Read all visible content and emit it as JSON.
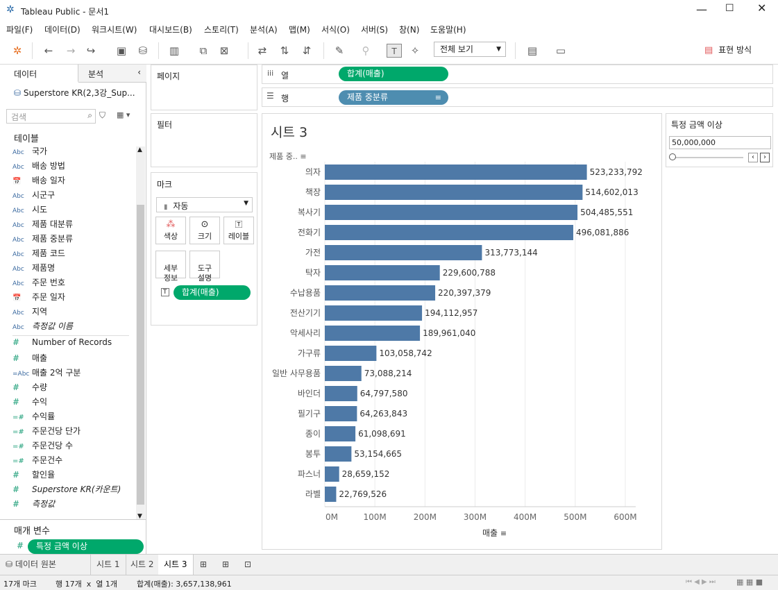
{
  "window": {
    "title": "Tableau Public - 문서1"
  },
  "menu": [
    "파일(F)",
    "데이터(D)",
    "워크시트(W)",
    "대시보드(B)",
    "스토리(T)",
    "분석(A)",
    "맵(M)",
    "서식(O)",
    "서버(S)",
    "창(N)",
    "도움말(H)"
  ],
  "toolbar": {
    "view_select": "전체 보기",
    "show_me": "표현 방식"
  },
  "left": {
    "tab_data": "데이터",
    "tab_analysis": "분석",
    "datasource": "Superstore KR(2,3강_Sup...",
    "search_placeholder": "검색",
    "tables_header": "테이블",
    "params_header": "매개 변수",
    "dimensions": [
      {
        "type": "Abc",
        "name": "국가"
      },
      {
        "type": "Abc",
        "name": "배송 방법"
      },
      {
        "type": "cal",
        "name": "배송 일자"
      },
      {
        "type": "Abc",
        "name": "시군구"
      },
      {
        "type": "Abc",
        "name": "시도"
      },
      {
        "type": "Abc",
        "name": "제품 대분류"
      },
      {
        "type": "Abc",
        "name": "제품 중분류"
      },
      {
        "type": "Abc",
        "name": "제품 코드"
      },
      {
        "type": "Abc",
        "name": "제품명"
      },
      {
        "type": "Abc",
        "name": "주문 번호"
      },
      {
        "type": "cal",
        "name": "주문 일자"
      },
      {
        "type": "Abc",
        "name": "지역"
      },
      {
        "type": "Abc",
        "name": "측정값 이름"
      }
    ],
    "measures": [
      {
        "type": "#",
        "name": "Number of Records"
      },
      {
        "type": "#",
        "name": "매출"
      },
      {
        "type": "=Abc",
        "name": "매출 2억 구분"
      },
      {
        "type": "#",
        "name": "수량"
      },
      {
        "type": "#",
        "name": "수익"
      },
      {
        "type": "=#",
        "name": "수익률"
      },
      {
        "type": "=#",
        "name": "주문건당 단가"
      },
      {
        "type": "=#",
        "name": "주문건당 수"
      },
      {
        "type": "=#",
        "name": "주문건수"
      },
      {
        "type": "#",
        "name": "할인율"
      },
      {
        "type": "#",
        "name": "Superstore KR(카운트)"
      },
      {
        "type": "#",
        "name": "측정값"
      }
    ],
    "parameter": "특정 금액 이상"
  },
  "cards": {
    "pages": "페이지",
    "filters": "필터",
    "marks": "마크",
    "mark_type": "자동",
    "color": "색상",
    "size": "크기",
    "label": "레이블",
    "detail": "세부\n정보",
    "tooltip": "도구\n설명",
    "label_pill": "합계(매출)"
  },
  "shelves": {
    "columns_label": "열",
    "rows_label": "행",
    "columns_pill": "합계(매출)",
    "rows_pill": "제품 중분류"
  },
  "sheet": {
    "title": "시트 3",
    "row_header": "제품 중..",
    "x_axis_title": "매출"
  },
  "param_card": {
    "title": "특정 금액 이상",
    "value": "50,000,000"
  },
  "tabs": {
    "datasource": "데이터 원본",
    "sheets": [
      "시트 1",
      "시트 2",
      "시트 3"
    ]
  },
  "status": {
    "marks": "17개 마크",
    "dims": "행 17개  x  열 1개",
    "sum": "합계(매출): 3,657,138,961"
  },
  "colors": {
    "bar": "#4e79a7",
    "green_pill": "#00a86b",
    "blue_pill": "#4e8db0"
  },
  "chart_data": {
    "type": "bar",
    "orientation": "horizontal",
    "categories": [
      "의자",
      "책장",
      "복사기",
      "전화기",
      "가전",
      "탁자",
      "수납용품",
      "전산기기",
      "악세사리",
      "가구류",
      "일반 사무용품",
      "바인더",
      "필기구",
      "종이",
      "봉투",
      "파스너",
      "라벨"
    ],
    "values": [
      523233792,
      514602013,
      504485551,
      496081886,
      313773144,
      229600788,
      220397379,
      194112957,
      189961040,
      103058742,
      73088214,
      64797580,
      64263843,
      61098691,
      53154665,
      28659152,
      22769526
    ],
    "labels": [
      "523,233,792",
      "514,602,013",
      "504,485,551",
      "496,081,886",
      "313,773,144",
      "229,600,788",
      "220,397,379",
      "194,112,957",
      "189,961,040",
      "103,058,742",
      "73,088,214",
      "64,797,580",
      "64,263,843",
      "61,098,691",
      "53,154,665",
      "28,659,152",
      "22,769,526"
    ],
    "xticks": [
      "0M",
      "100M",
      "200M",
      "300M",
      "400M",
      "500M",
      "600M"
    ],
    "xlim": [
      0,
      600000000
    ],
    "xlabel": "매출"
  }
}
